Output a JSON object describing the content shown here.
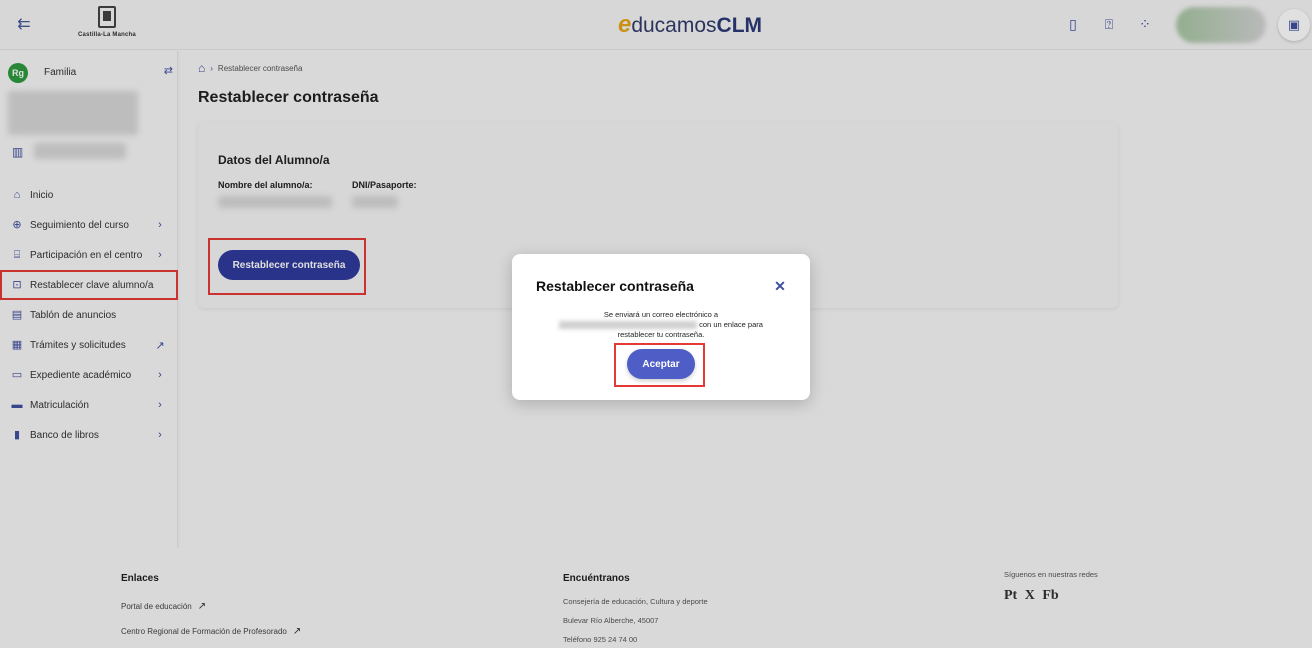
{
  "header": {
    "logo_text": "Castilla-La Mancha",
    "brand_e": "e",
    "brand_ducamos": "ducamos",
    "brand_clm": "CLM",
    "icons": [
      "menu-collapse-icon",
      "book-icon",
      "help-icon",
      "apps-grid-icon",
      "panel-icon"
    ]
  },
  "sidebar": {
    "profile_badge": "Rg",
    "profile_label": "Familia",
    "items": [
      {
        "label": "Inicio",
        "icon": "home-icon",
        "chevron": false
      },
      {
        "label": "Seguimiento del curso",
        "icon": "search-course-icon",
        "chevron": true
      },
      {
        "label": "Participación en el centro",
        "icon": "building-icon",
        "chevron": true
      },
      {
        "label": "Restablecer clave alumno/a",
        "icon": "lock-icon",
        "chevron": false
      },
      {
        "label": "Tablón de anuncios",
        "icon": "board-icon",
        "chevron": false
      },
      {
        "label": "Trámites y solicitudes",
        "icon": "form-icon",
        "external": true
      },
      {
        "label": "Expediente académico",
        "icon": "archive-icon",
        "chevron": true
      },
      {
        "label": "Matriculación",
        "icon": "briefcase-icon",
        "chevron": true
      },
      {
        "label": "Banco de libros",
        "icon": "book-bank-icon",
        "chevron": true
      }
    ],
    "active_index": 3
  },
  "breadcrumb": {
    "current": "Restablecer contraseña"
  },
  "main": {
    "title": "Restablecer contraseña",
    "card_title": "Datos del Alumno/a",
    "field_name_label": "Nombre del alumno/a:",
    "field_dni_label": "DNI/Pasaporte:",
    "reset_button": "Restablecer contraseña"
  },
  "footer": {
    "links_heading": "Enlaces",
    "link_1": "Portal de educación",
    "link_2": "Centro Regional de Formación de Profesorado",
    "contact_heading": "Encuéntranos",
    "contact_1": "Consejería de educación, Cultura y deporte",
    "contact_2": "Bulevar Río Alberche, 45007",
    "contact_3": "Teléfono 925 24 74 00",
    "social_heading": "Síguenos en nuestras redes",
    "social_pt": "Pt",
    "social_x": "X",
    "social_fb": "Fb"
  },
  "modal": {
    "title": "Restablecer contraseña",
    "close": "✕",
    "text_1": "Se enviará un correo electrónico a",
    "text_2": "con un enlace para restablecer tu contraseña.",
    "accept": "Aceptar"
  },
  "colors": {
    "accent": "#2f3b9c",
    "accept_button": "#4f5ec7",
    "highlight": "#e53935",
    "brand_e": "#e6a617",
    "profile_badge": "#2e9a3e"
  }
}
